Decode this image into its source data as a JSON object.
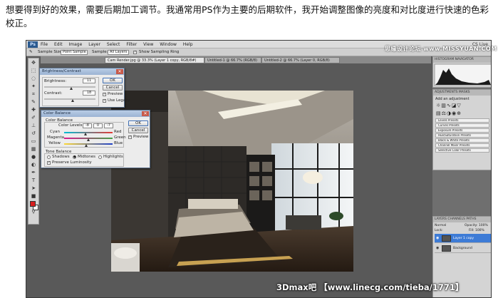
{
  "caption": "想要得到好的效果，需要后期加工调节。我通常用PS作为主要的后期软件，我开始调整图像的亮度和对比度进行快速的色彩校正。",
  "photoshop": {
    "menus": [
      "File",
      "Edit",
      "Image",
      "Layer",
      "Select",
      "Filter",
      "View",
      "Window",
      "Help"
    ],
    "workspace": "CS Live",
    "options": {
      "sample_size_label": "Sample Size:",
      "sample_size_value": "Point Sample",
      "sample_label": "Sample:",
      "sample_value": "All Layers",
      "show_ring": "Show Sampling Ring"
    },
    "tabs": [
      "Cam Render.jpg @ 33.3% (Layer 1 copy, RGB/8#)",
      "Untitled-1 @ 66.7% (RGB/8)",
      "Untitled-2 @ 66.7% (Layer 0, RGB/8)"
    ],
    "brightness_contrast": {
      "title": "Brightness/Contrast",
      "brightness_label": "Brightness:",
      "brightness_value": "11",
      "contrast_label": "Contrast:",
      "contrast_value": "18",
      "ok": "OK",
      "cancel": "Cancel",
      "preview": "Preview",
      "use_legacy": "Use Legacy"
    },
    "color_balance": {
      "title": "Color Balance",
      "group_label": "Color Balance",
      "levels_label": "Color Levels:",
      "levels": [
        "-8",
        "0",
        "-7"
      ],
      "rows": [
        {
          "left": "Cyan",
          "right": "Red",
          "level": -8
        },
        {
          "left": "Magenta",
          "right": "Green",
          "level": 0
        },
        {
          "left": "Yellow",
          "right": "Blue",
          "level": -7
        }
      ],
      "tone_label": "Tone Balance",
      "tones": [
        "Shadows",
        "Midtones",
        "Highlights"
      ],
      "preserve": "Preserve Luminosity",
      "ok": "OK",
      "cancel": "Cancel",
      "preview": "Preview"
    },
    "panels": {
      "histogram_tabs": "HISTOGRAM  NAVIGATOR",
      "adjustments_tabs": "ADJUSTMENTS  MASKS",
      "add_adjustment": "Add an adjustment",
      "presets": [
        "Levels Presets",
        "Curves Presets",
        "Exposure Presets",
        "Hue/Saturation Presets",
        "Black & White Presets",
        "Channel Mixer Presets",
        "Selective Color Presets"
      ],
      "layers_tabs": "LAYERS  CHANNELS  PATHS",
      "normal": "Normal",
      "opacity": "Opacity: 100%",
      "lock": "Lock:",
      "fill": "Fill: 100%",
      "layers": [
        "Layer 1 copy",
        "Background"
      ]
    }
  },
  "watermarks": {
    "top": "思缘设计论坛 www.MISSYUAN.COM",
    "bottom": "3Dmax吧 【www.linecg.com/tieba/1771】"
  }
}
